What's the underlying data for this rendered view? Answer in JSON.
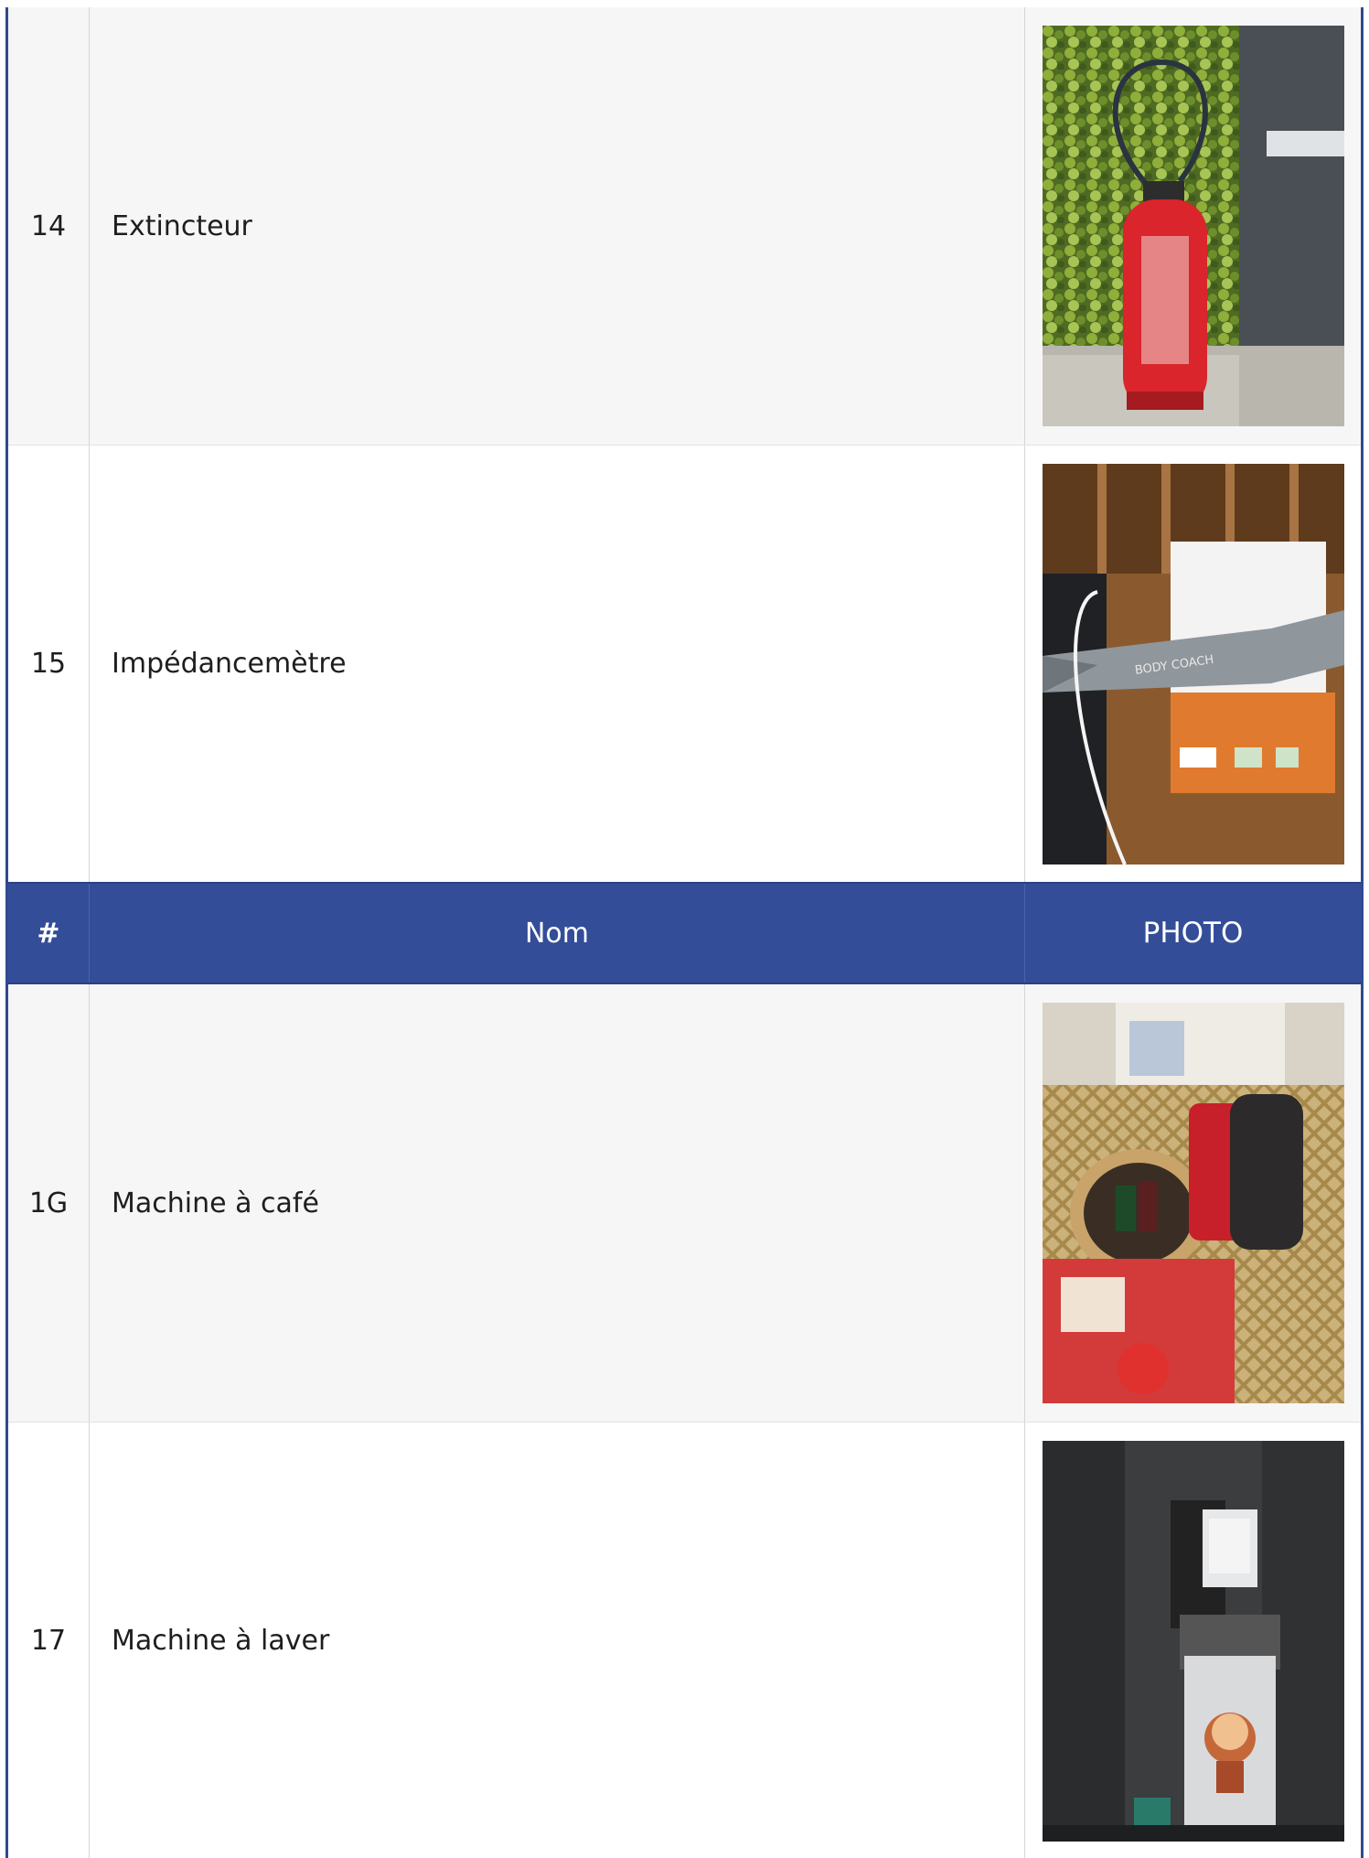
{
  "header": {
    "num_label": "#",
    "name_label": "Nom",
    "photo_label": "PHOTO"
  },
  "rows_before_header": [
    {
      "num": "14",
      "name": "Extincteur",
      "photo_icon": "fire-extinguisher-photo"
    },
    {
      "num": "15",
      "name": "Impédancemètre",
      "photo_icon": "impedance-meter-photo"
    }
  ],
  "rows_after_header": [
    {
      "num": "1G",
      "name": "Machine à café",
      "photo_icon": "coffee-machine-photo"
    },
    {
      "num": "17",
      "name": "Machine à laver",
      "photo_icon": "washing-machine-photo"
    }
  ],
  "photo_texts": {
    "impedance_brand": "BODY COACH"
  },
  "colors": {
    "header_bg": "#334d98",
    "border": "#2f4a8f",
    "row_alt": "#f6f6f6"
  }
}
